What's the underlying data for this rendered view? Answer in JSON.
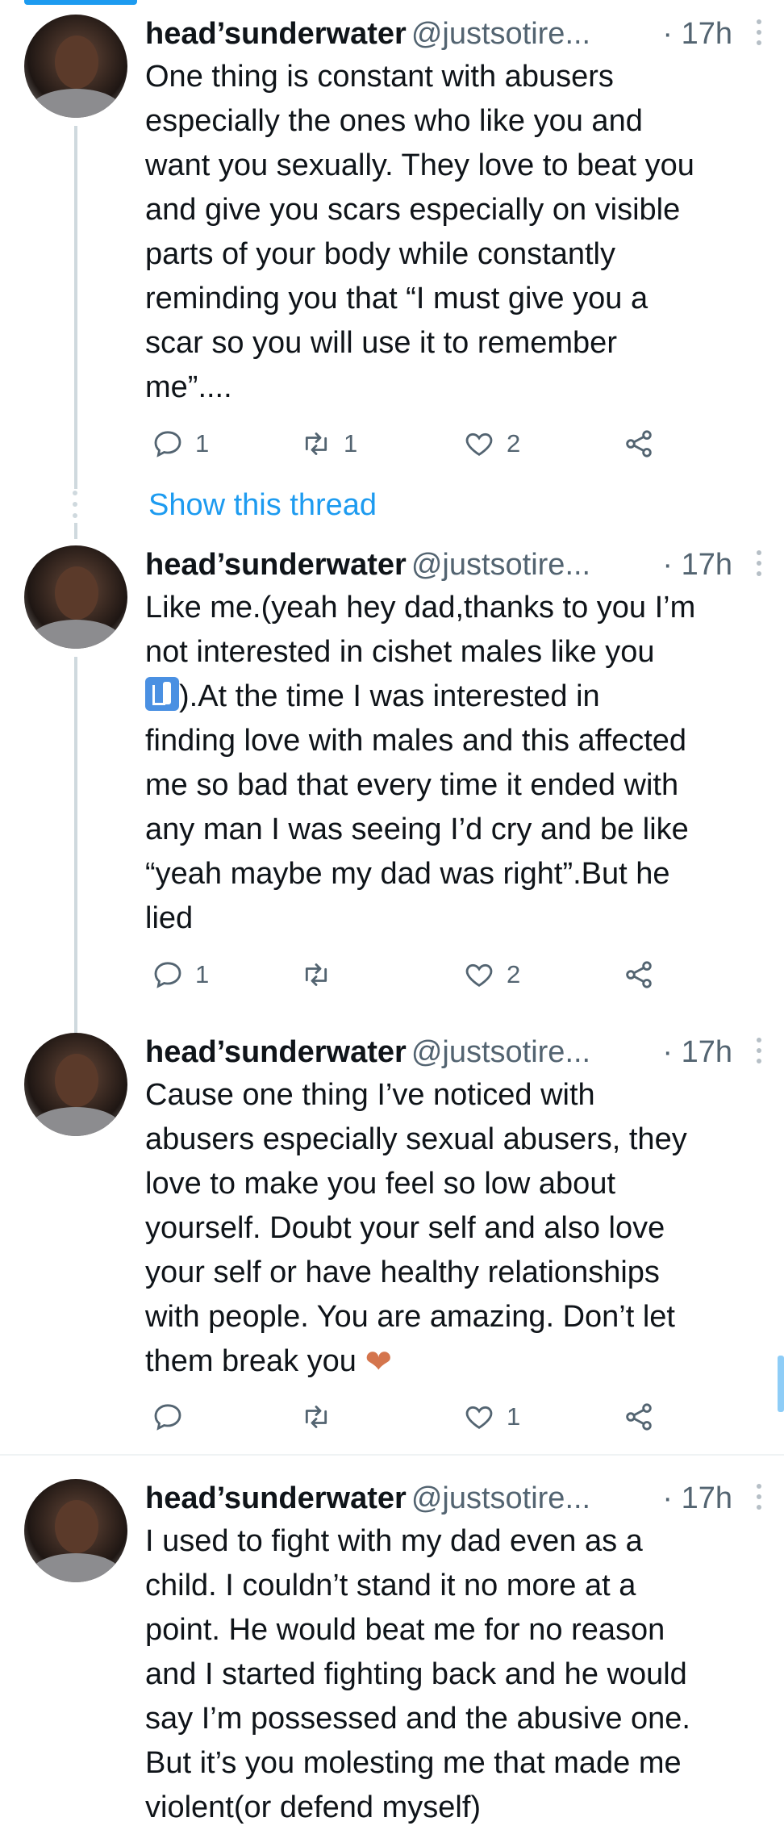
{
  "tweets": [
    {
      "display_name": "head’sunderwater",
      "handle": "@justsotire...",
      "time": "· 17h",
      "text": "One thing is constant with abusers\nespecially the ones who like you and\nwant you sexually. They love to beat you\nand give you scars especially on visible\nparts of your body while constantly\nreminding you that “I must give you a\nscar so you will use it to remember\nme”....",
      "replies": "1",
      "retweets": "1",
      "likes": "2"
    },
    {
      "display_name": "head’sunderwater",
      "handle": "@justsotire...",
      "time": "· 17h",
      "text_a": "Like me.(yeah hey dad,thanks to you I’m\nnot interested in cishet males like you\n",
      "emoji": "family-icon",
      "text_b": ").At the time I was interested in\nfinding love with males and this affected\nme so bad that every time it ended with\nany man I was seeing I’d cry and be like\n“yeah maybe my dad was right”.But he\nlied",
      "replies": "1",
      "retweets": "",
      "likes": "2"
    },
    {
      "display_name": "head’sunderwater",
      "handle": "@justsotire...",
      "time": "· 17h",
      "text": "Cause one thing I’ve noticed with\nabusers especially sexual abusers, they\nlove to make you feel so low about\nyourself. Doubt your self and also love\nyour self or have healthy relationships\nwith people. You are amazing. Don’t let\nthem break you ",
      "heart_emoji": "❤",
      "replies": "",
      "retweets": "",
      "likes": "1"
    },
    {
      "display_name": "head’sunderwater",
      "handle": "@justsotire...",
      "time": "· 17h",
      "text": "I used to fight with my dad even as a\nchild. I couldn’t stand it no more at a\npoint. He would beat me for no reason\nand I started fighting back and he would\nsay I’m possessed and the abusive one.\nBut it’s you molesting me that made me\nviolent(or defend myself)"
    }
  ],
  "show_thread_label": "Show this thread",
  "colors": {
    "accent": "#1d9bf0",
    "text": "#0f1419",
    "muted": "#536471",
    "heart_emoji": "#d4754d"
  }
}
